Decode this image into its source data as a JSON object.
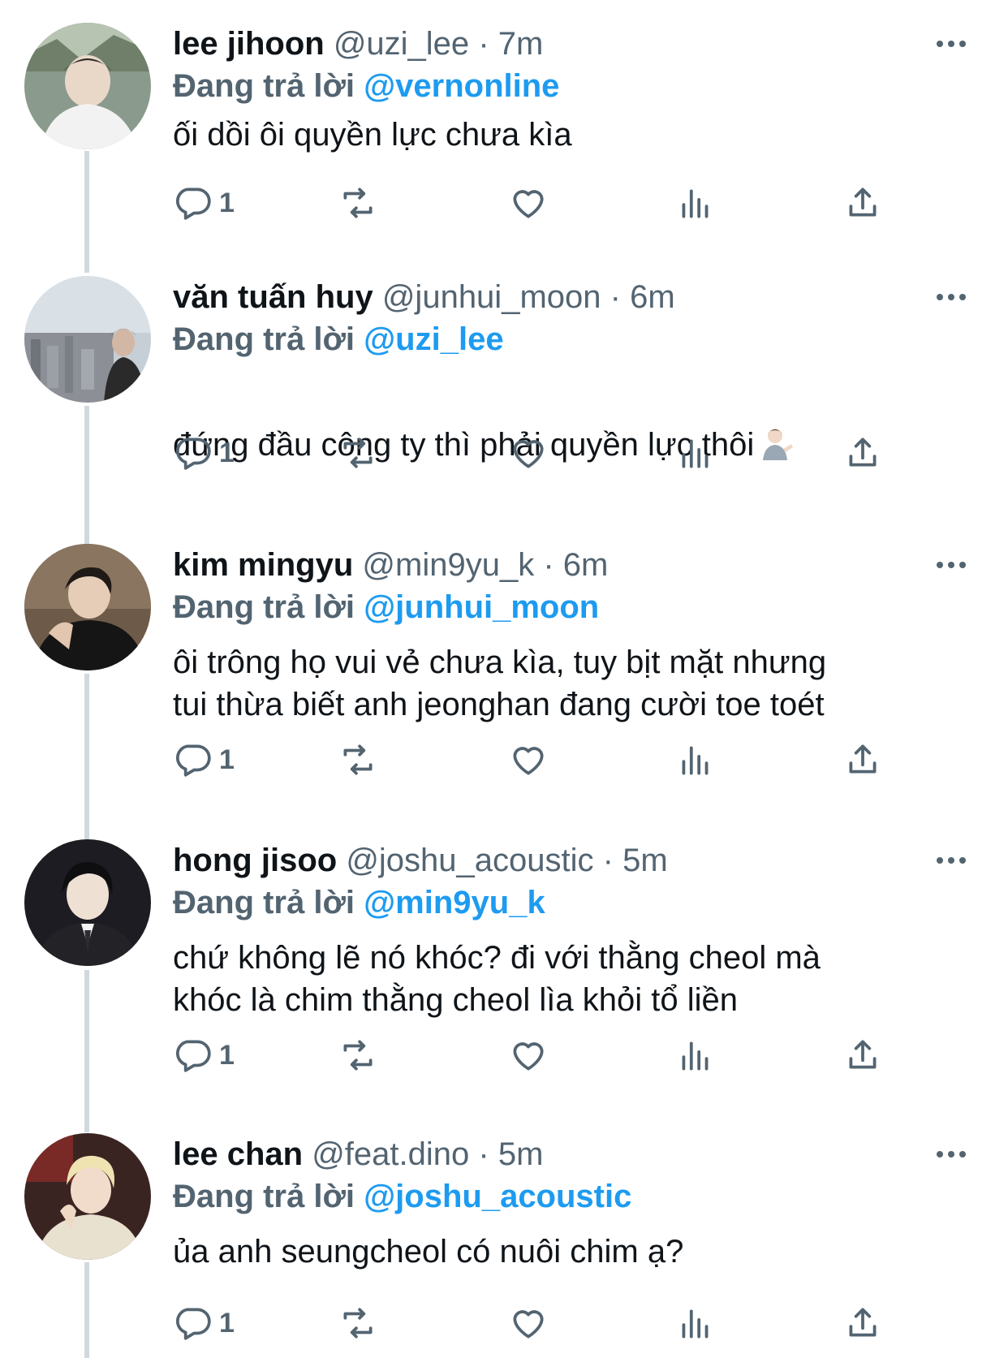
{
  "tweets": [
    {
      "name": "lee jihoon",
      "handle": "@uzi_lee",
      "dot": "·",
      "time": "7m",
      "reply_prefix": "Đang trả lời",
      "reply_to": "@vernonline",
      "text": "ối dồi ôi quyền lực chưa kìa",
      "reply_count": "1"
    },
    {
      "name": "văn tuấn huy",
      "handle": "@junhui_moon",
      "dot": "·",
      "time": "6m",
      "reply_prefix": "Đang trả lời",
      "reply_to": "@uzi_lee",
      "text": "đứng đầu công ty thì phải quyền lực thôi",
      "emoji": "person-tipping-hand-emoji",
      "reply_count": "1"
    },
    {
      "name": "kim mingyu",
      "handle": "@min9yu_k",
      "dot": "·",
      "time": "6m",
      "reply_prefix": "Đang trả lời",
      "reply_to": "@junhui_moon",
      "text": "ôi trông họ vui vẻ chưa kìa, tuy bịt mặt nhưng\ntui thừa biết anh jeonghan đang cười toe toét",
      "reply_count": "1"
    },
    {
      "name": "hong jisoo",
      "handle": "@joshu_acoustic",
      "dot": "·",
      "time": "5m",
      "reply_prefix": "Đang trả lời",
      "reply_to": "@min9yu_k",
      "text": "chứ không lẽ nó khóc? đi với thằng cheol mà\nkhóc là chim thằng cheol lìa khỏi tổ liền",
      "reply_count": "1"
    },
    {
      "name": "lee chan",
      "handle": "@feat.dino",
      "dot": "·",
      "time": "5m",
      "reply_prefix": "Đang trả lời",
      "reply_to": "@joshu_acoustic",
      "text": "ủa anh seungcheol có nuôi chim ạ?",
      "reply_count": "1"
    }
  ],
  "icons": {
    "reply": "reply-icon",
    "retweet": "retweet-icon",
    "like": "like-icon",
    "views": "views-icon",
    "share": "share-icon",
    "more": "more-icon"
  },
  "colors": {
    "link": "#1d9bf0",
    "secondary": "#536471",
    "text": "#0f1419",
    "thread_line": "#cfd9de"
  }
}
